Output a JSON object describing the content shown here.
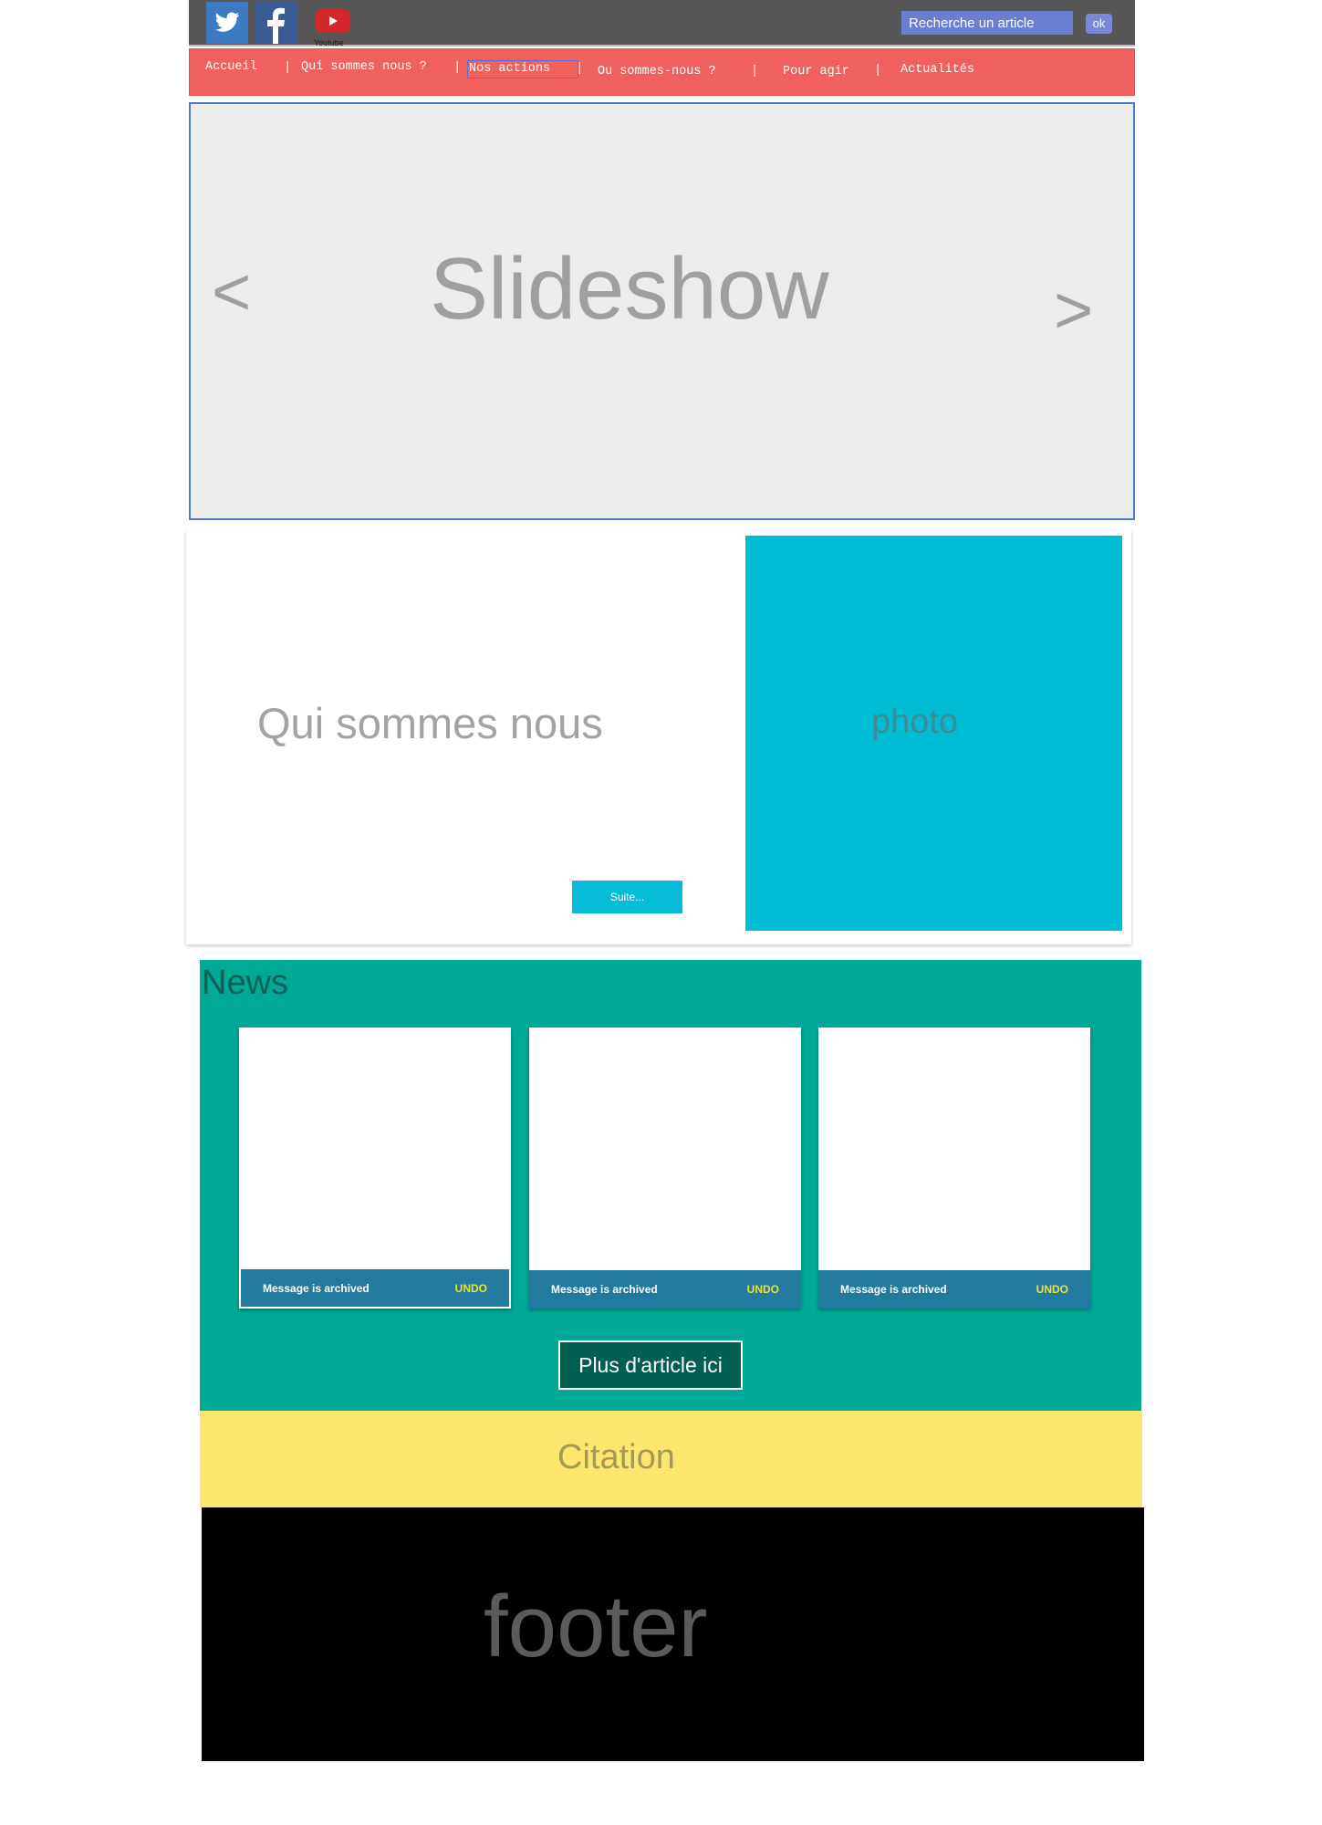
{
  "header": {
    "social": [
      {
        "name": "twitter",
        "icon": "twitter-icon",
        "color": "#3c7bc2"
      },
      {
        "name": "facebook",
        "icon": "facebook-icon",
        "color": "#3b5b97"
      },
      {
        "name": "youtube",
        "icon": "youtube-icon",
        "color": "#d3252a",
        "label": "Youtube"
      }
    ],
    "search": {
      "value": "Recherche un article",
      "button_label": "ok"
    }
  },
  "nav": {
    "items": [
      "Accueil",
      "Qui sommes nous ?",
      "Nos actions",
      "Ou sommes-nous ?",
      "Pour agir",
      "Actualités"
    ],
    "separator": "|",
    "color": "#f0615e"
  },
  "slideshow": {
    "title": "Slideshow",
    "prev_label": "<",
    "next_label": ">"
  },
  "about": {
    "title": "Qui sommes nous",
    "button_label": "Suite...",
    "photo_label": "photo"
  },
  "news": {
    "title": "News",
    "cards": [
      {
        "message": "Message is archived",
        "action": "UNDO"
      },
      {
        "message": "Message is archived",
        "action": "UNDO"
      },
      {
        "message": "Message is archived",
        "action": "UNDO"
      }
    ],
    "more_button_label": "Plus d'article ici",
    "color": "#00a896"
  },
  "citation": {
    "label": "Citation",
    "color": "#fde66f"
  },
  "footer": {
    "label": "footer"
  }
}
